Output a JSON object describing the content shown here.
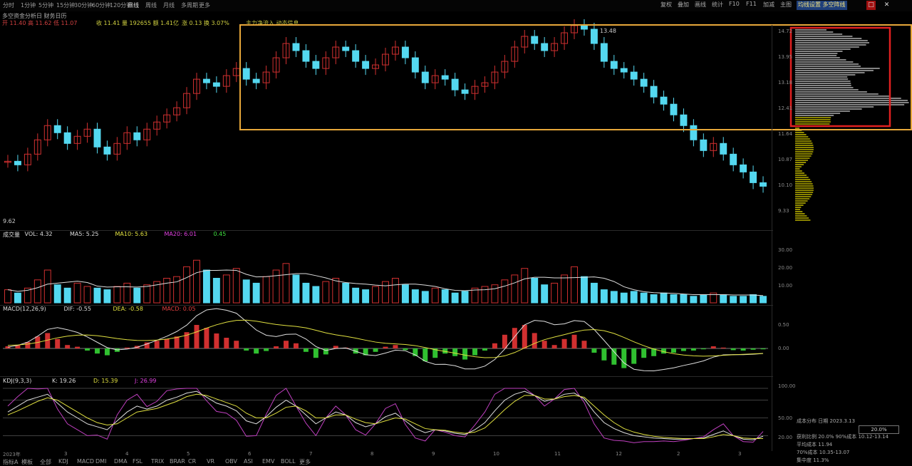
{
  "menubar": {
    "items": [
      "分时",
      "1分钟",
      "5分钟",
      "15分钟",
      "30分钟",
      "60分钟",
      "120分钟",
      "日线",
      "周线",
      "月线",
      "多周期",
      "更多"
    ],
    "active_index": 7
  },
  "toolbar": {
    "buttons": [
      "复权",
      "叠加",
      "画线",
      "统计",
      "F10",
      "F11",
      "加减",
      "主图"
    ],
    "badge": "均线设置 多空阵线",
    "window_buttons": [
      "□",
      "✕"
    ]
  },
  "info": {
    "line1": "多空资金分析日 财务日历",
    "line2_a": "开 11.40  高 11.62  低 11.07",
    "line2_b": "收 11.41  量 192655  额 1.41亿",
    "line2_c": "涨 0.13  换 3.07%",
    "line2_d": "主力净流入 动态信息",
    "max_label": "13.48",
    "min_label": "9.62"
  },
  "price_ticks": [
    "14.72",
    "13.95",
    "13.18",
    "12.41",
    "11.64",
    "10.87",
    "10.10",
    "9.33"
  ],
  "volume": {
    "header": [
      {
        "text": "成交量",
        "color": "#dddddd"
      },
      {
        "text": "VOL: 4.32",
        "color": "#dddddd"
      },
      {
        "text": "MA5: 5.25",
        "color": "#dddddd"
      },
      {
        "text": "MA10: 5.63",
        "color": "#e0e040"
      },
      {
        "text": "MA20: 6.01",
        "color": "#e040e0"
      },
      {
        "text": "0.45",
        "color": "#40e040"
      }
    ],
    "ticks": [
      "30.00",
      "20.00",
      "10.00"
    ]
  },
  "macd": {
    "header": [
      {
        "text": "MACD(12,26,9)",
        "color": "#dddddd"
      },
      {
        "text": "DIF: -0.55",
        "color": "#dddddd"
      },
      {
        "text": "DEA: -0.58",
        "color": "#e0e040"
      },
      {
        "text": "MACD: 0.05",
        "color": "#e04040"
      }
    ],
    "ticks": [
      "0.50",
      "0.00"
    ]
  },
  "kdj": {
    "header": [
      {
        "text": "KDJ(9,3,3)",
        "color": "#dddddd"
      },
      {
        "text": "K: 19.26",
        "color": "#dddddd"
      },
      {
        "text": "D: 15.39",
        "color": "#e0e040"
      },
      {
        "text": "J: 26.99",
        "color": "#e040e0"
      }
    ],
    "ticks": [
      "100.00",
      "50.00",
      "20.00"
    ]
  },
  "x_ticks": [
    "2023年",
    "3",
    "4",
    "5",
    "6",
    "7",
    "8",
    "9",
    "10",
    "11",
    "12",
    "2",
    "3"
  ],
  "bottom_tabs": [
    "指标A",
    "模板",
    "全部",
    "KDJ",
    "MACD",
    "DMI",
    "DMA",
    "FSL",
    "TRIX",
    "BRAR",
    "CR",
    "VR",
    "OBV",
    "ASI",
    "EMV",
    "BOLL",
    "更多"
  ],
  "info_panel": {
    "rows": [
      "成本分布 日期 2023.3.13",
      "获利比例 20.0%  90%成本 10.12-13.14",
      "平均成本 11.94",
      "70%成本 10.35-13.07",
      "集中度 11.3%"
    ],
    "ratio_box": "20.0%"
  },
  "colors": {
    "up": "#d03030",
    "down": "#54d8f0",
    "highlight_box": "#e8a83a",
    "highlight_box_red": "#e02020",
    "chip_gray": "#b0b0b0",
    "chip_yellow": "#b8b000"
  },
  "chart_data": {
    "type": "candlestick",
    "price_series": [
      11.0,
      10.9,
      11.2,
      11.6,
      12.0,
      11.8,
      11.5,
      11.7,
      11.9,
      11.4,
      11.2,
      11.5,
      11.8,
      11.6,
      11.9,
      12.1,
      12.3,
      12.5,
      12.9,
      13.3,
      13.2,
      13.1,
      13.4,
      13.6,
      13.3,
      13.2,
      13.5,
      13.9,
      14.3,
      14.1,
      13.8,
      13.6,
      13.9,
      14.2,
      14.1,
      13.8,
      13.6,
      13.7,
      14.0,
      14.2,
      13.9,
      13.5,
      13.2,
      13.4,
      13.3,
      13.0,
      12.9,
      13.1,
      13.2,
      13.5,
      13.8,
      14.2,
      14.5,
      14.3,
      14.1,
      14.3,
      14.6,
      14.8,
      14.7,
      14.3,
      13.8,
      13.6,
      13.5,
      13.3,
      13.1,
      12.8,
      12.6,
      12.3,
      12.0,
      11.6,
      11.3,
      11.5,
      11.2,
      10.9,
      10.7,
      10.4,
      10.3
    ],
    "volume_series": [
      8,
      6,
      9,
      14,
      20,
      11,
      9,
      12,
      10,
      9,
      8,
      10,
      12,
      9,
      11,
      13,
      15,
      16,
      22,
      26,
      20,
      15,
      17,
      21,
      14,
      12,
      16,
      20,
      24,
      17,
      12,
      10,
      13,
      15,
      12,
      9,
      8,
      10,
      13,
      15,
      11,
      8,
      7,
      9,
      8,
      6,
      7,
      9,
      10,
      11,
      14,
      17,
      21,
      15,
      11,
      12,
      17,
      22,
      16,
      12,
      8,
      7,
      6,
      7,
      6,
      5,
      6,
      5,
      5,
      4,
      5,
      6,
      5,
      4,
      4,
      5,
      4
    ],
    "macd_series": [
      0.05,
      0.08,
      0.15,
      0.28,
      0.36,
      0.22,
      0.08,
      0.04,
      -0.05,
      -0.12,
      -0.16,
      -0.08,
      0.02,
      0.06,
      0.14,
      0.18,
      0.22,
      0.28,
      0.38,
      0.55,
      0.48,
      0.35,
      0.25,
      0.18,
      -0.05,
      -0.12,
      -0.06,
      0.05,
      0.18,
      0.12,
      -0.08,
      -0.22,
      -0.14,
      0.06,
      0.02,
      -0.12,
      -0.16,
      -0.08,
      0.04,
      0.08,
      -0.04,
      -0.18,
      -0.3,
      -0.22,
      -0.12,
      -0.18,
      -0.26,
      -0.16,
      -0.05,
      0.12,
      0.32,
      0.48,
      0.55,
      0.36,
      0.18,
      0.08,
      0.22,
      0.32,
      0.18,
      -0.1,
      -0.28,
      -0.38,
      -0.46,
      -0.36,
      -0.22,
      -0.18,
      -0.12,
      -0.1,
      -0.06,
      -0.05,
      -0.02,
      0.05,
      0.02,
      -0.04,
      -0.05,
      -0.03,
      -0.02
    ],
    "kdj_k": [
      60,
      70,
      80,
      85,
      90,
      75,
      60,
      50,
      40,
      35,
      30,
      45,
      60,
      70,
      65,
      70,
      80,
      85,
      92,
      95,
      85,
      75,
      70,
      62,
      45,
      40,
      52,
      68,
      80,
      70,
      55,
      40,
      50,
      60,
      55,
      42,
      35,
      40,
      52,
      58,
      45,
      32,
      25,
      30,
      28,
      24,
      22,
      30,
      42,
      62,
      80,
      90,
      95,
      88,
      78,
      82,
      90,
      92,
      82,
      60,
      42,
      32,
      25,
      20,
      18,
      16,
      15,
      14,
      14,
      15,
      16,
      22,
      28,
      20,
      14,
      13,
      19
    ],
    "kdj_d": [
      55,
      62,
      70,
      78,
      84,
      80,
      70,
      60,
      50,
      42,
      38,
      40,
      50,
      60,
      63,
      66,
      72,
      78,
      86,
      90,
      88,
      82,
      76,
      70,
      58,
      50,
      50,
      58,
      68,
      70,
      62,
      50,
      50,
      55,
      55,
      48,
      42,
      40,
      45,
      50,
      48,
      40,
      32,
      30,
      29,
      26,
      24,
      26,
      33,
      48,
      64,
      78,
      88,
      88,
      82,
      82,
      86,
      88,
      85,
      70,
      55,
      42,
      32,
      26,
      22,
      19,
      17,
      16,
      15,
      15,
      15,
      18,
      22,
      20,
      16,
      15,
      15
    ],
    "x_labels": [
      "2023年",
      "3",
      "4",
      "5",
      "6",
      "7",
      "8",
      "9",
      "10",
      "11",
      "12",
      "2",
      "3"
    ],
    "ylim": [
      9.33,
      14.72
    ]
  }
}
